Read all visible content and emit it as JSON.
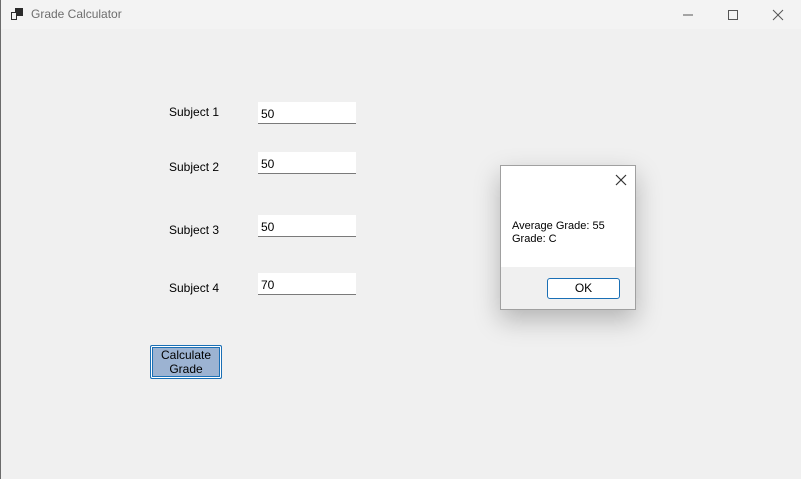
{
  "window": {
    "title": "Grade Calculator"
  },
  "form": {
    "subjects": [
      {
        "label": "Subject 1",
        "value": "50"
      },
      {
        "label": "Subject 2",
        "value": "50"
      },
      {
        "label": "Subject 3",
        "value": "50"
      },
      {
        "label": "Subject 4",
        "value": "70"
      }
    ],
    "calculate_label_line1": "Calculate",
    "calculate_label_line2": "Grade"
  },
  "dialog": {
    "message_line1": "Average Grade: 55",
    "message_line2": "Grade: C",
    "ok_label": "OK"
  },
  "colors": {
    "background": "#f0f0f0",
    "button_fill": "#9cb3d2",
    "accent_border": "#1a6fb5"
  }
}
